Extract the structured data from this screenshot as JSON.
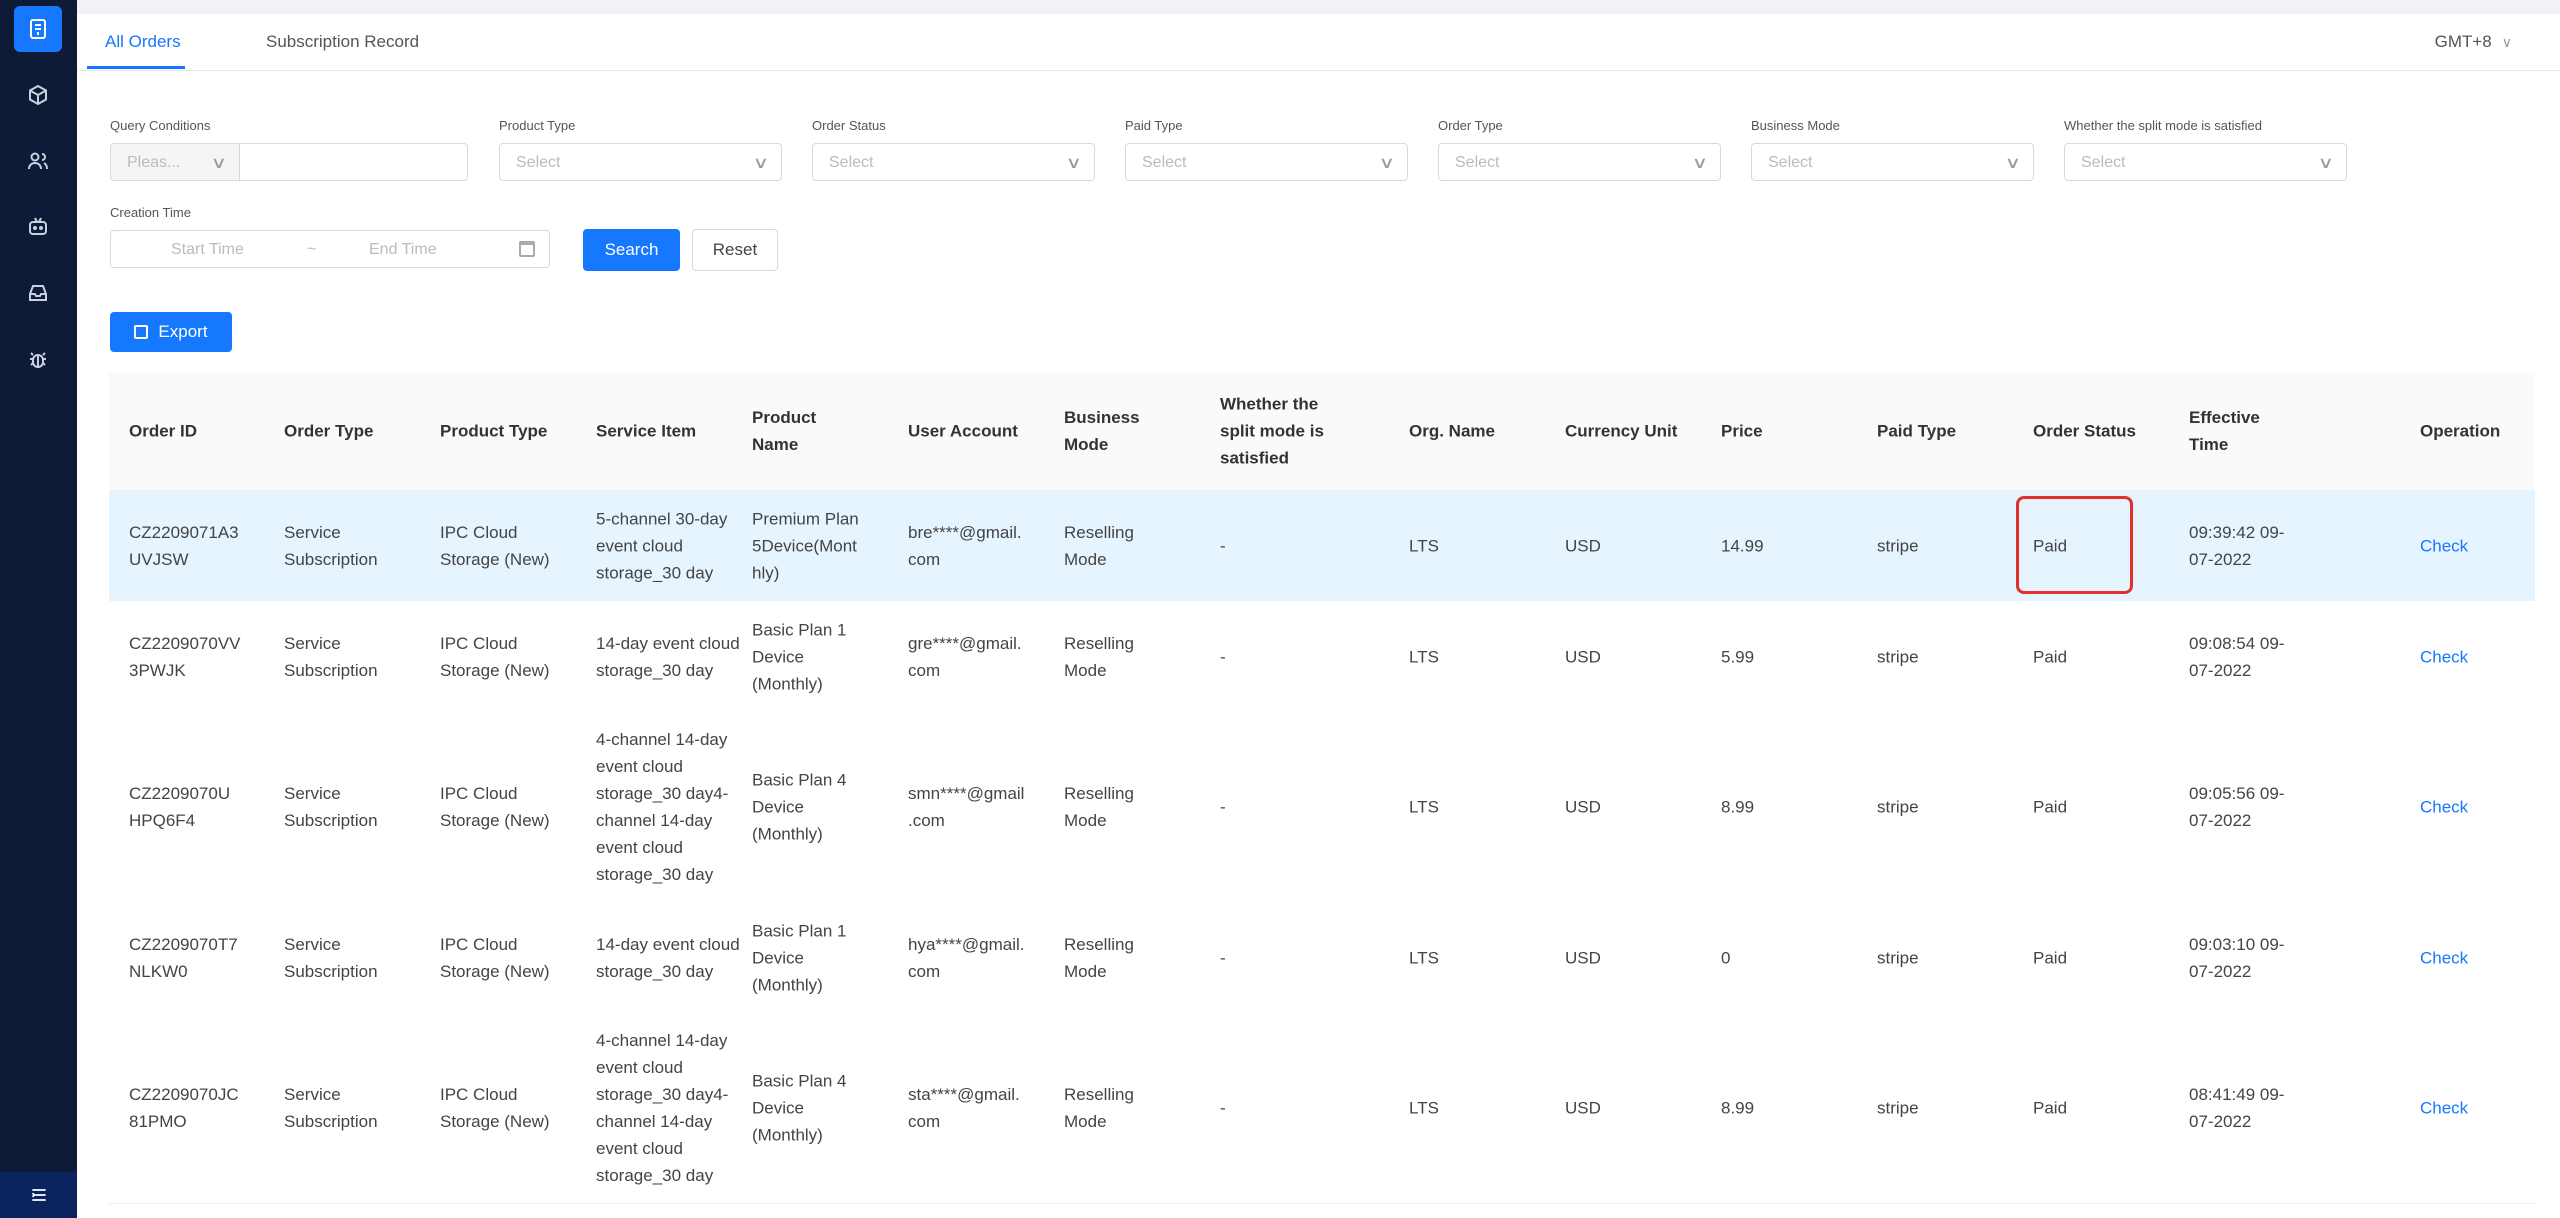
{
  "sidebar": {
    "items": [
      {
        "icon": "orders-icon",
        "active": true
      },
      {
        "icon": "box-icon",
        "active": false
      },
      {
        "icon": "users-icon",
        "active": false
      },
      {
        "icon": "bot-icon",
        "active": false
      },
      {
        "icon": "inbox-icon",
        "active": false
      },
      {
        "icon": "bug-icon",
        "active": false
      }
    ],
    "collapse_icon": "menu-fold-icon"
  },
  "tabs": {
    "all_orders": "All Orders",
    "subscription_record": "Subscription Record",
    "timezone": "GMT+8"
  },
  "filters": {
    "query_conditions": {
      "label": "Query Conditions",
      "type_placeholder": "Pleas...",
      "value": ""
    },
    "product_type": {
      "label": "Product Type",
      "placeholder": "Select"
    },
    "order_status": {
      "label": "Order Status",
      "placeholder": "Select"
    },
    "paid_type": {
      "label": "Paid Type",
      "placeholder": "Select"
    },
    "order_type": {
      "label": "Order Type",
      "placeholder": "Select"
    },
    "business_mode": {
      "label": "Business Mode",
      "placeholder": "Select"
    },
    "split_mode": {
      "label": "Whether the split mode is satisfied",
      "placeholder": "Select"
    },
    "creation_time": {
      "label": "Creation Time",
      "start_placeholder": "Start Time",
      "end_placeholder": "End Time"
    },
    "search_label": "Search",
    "reset_label": "Reset",
    "export_label": "Export"
  },
  "table": {
    "columns": [
      "Order ID",
      "Order Type",
      "Product Type",
      "Service Item",
      "Product\nName",
      "User Account",
      "Business\nMode",
      "Whether the\nsplit mode is\nsatisfied",
      "Org. Name",
      "Currency Unit",
      "Price",
      "Paid Type",
      "Order Status",
      "Effective\nTime",
      "Operation"
    ],
    "rows": [
      {
        "order_id": "CZ2209071A3\nUVJSW",
        "order_type": "Service\nSubscription",
        "product_type": "IPC Cloud\nStorage (New)",
        "service_item": "5-channel 30-day\nevent cloud\nstorage_30 day",
        "product_name": "Premium Plan\n5Device(Mont\nhly)",
        "user_account": "bre****@gmail.\ncom",
        "business_mode": "Reselling\nMode",
        "split_mode": "-",
        "org_name": "LTS",
        "currency": "USD",
        "price": "14.99",
        "paid_type": "stripe",
        "order_status": "Paid",
        "effective_time": "09:39:42 09-\n07-2022",
        "operation": "Check",
        "highlighted": true
      },
      {
        "order_id": "CZ2209070VV\n3PWJK",
        "order_type": "Service\nSubscription",
        "product_type": "IPC Cloud\nStorage (New)",
        "service_item": "14-day event cloud\nstorage_30 day",
        "product_name": "Basic Plan 1\nDevice\n(Monthly)",
        "user_account": "gre****@gmail.\ncom",
        "business_mode": "Reselling\nMode",
        "split_mode": "-",
        "org_name": "LTS",
        "currency": "USD",
        "price": "5.99",
        "paid_type": "stripe",
        "order_status": "Paid",
        "effective_time": "09:08:54 09-\n07-2022",
        "operation": "Check",
        "highlighted": false
      },
      {
        "order_id": "CZ2209070U\nHPQ6F4",
        "order_type": "Service\nSubscription",
        "product_type": "IPC Cloud\nStorage (New)",
        "service_item": "4-channel 14-day\nevent cloud\nstorage_30 day4-\nchannel 14-day\nevent cloud\nstorage_30 day",
        "product_name": "Basic Plan 4\nDevice\n(Monthly)",
        "user_account": "smn****@gmail\n.com",
        "business_mode": "Reselling\nMode",
        "split_mode": "-",
        "org_name": "LTS",
        "currency": "USD",
        "price": "8.99",
        "paid_type": "stripe",
        "order_status": "Paid",
        "effective_time": "09:05:56 09-\n07-2022",
        "operation": "Check",
        "highlighted": false
      },
      {
        "order_id": "CZ2209070T7\nNLKW0",
        "order_type": "Service\nSubscription",
        "product_type": "IPC Cloud\nStorage (New)",
        "service_item": "14-day event cloud\nstorage_30 day",
        "product_name": "Basic Plan 1\nDevice\n(Monthly)",
        "user_account": "hya****@gmail.\ncom",
        "business_mode": "Reselling\nMode",
        "split_mode": "-",
        "org_name": "LTS",
        "currency": "USD",
        "price": "0",
        "paid_type": "stripe",
        "order_status": "Paid",
        "effective_time": "09:03:10 09-\n07-2022",
        "operation": "Check",
        "highlighted": false
      },
      {
        "order_id": "CZ2209070JC\n81PMO",
        "order_type": "Service\nSubscription",
        "product_type": "IPC Cloud\nStorage (New)",
        "service_item": "4-channel 14-day\nevent cloud\nstorage_30 day4-\nchannel 14-day\nevent cloud\nstorage_30 day",
        "product_name": "Basic Plan 4\nDevice\n(Monthly)",
        "user_account": "sta****@gmail.\ncom",
        "business_mode": "Reselling\nMode",
        "split_mode": "-",
        "org_name": "LTS",
        "currency": "USD",
        "price": "8.99",
        "paid_type": "stripe",
        "order_status": "Paid",
        "effective_time": "08:41:49 09-\n07-2022",
        "operation": "Check",
        "highlighted": false
      }
    ]
  },
  "colors": {
    "accent": "#1677ff",
    "sidebar_bg": "#0d1b36",
    "highlight_row": "#e6f4ff",
    "annotation_box": "#e3302a"
  }
}
